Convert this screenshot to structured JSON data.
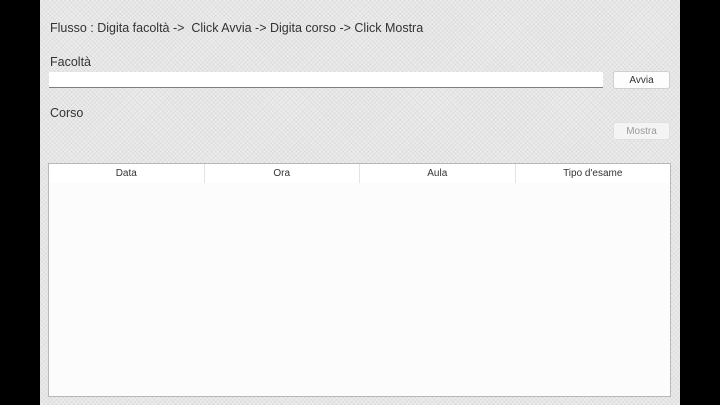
{
  "flow": {
    "text": "Flusso : Digita facoltà ->  Click Avvia -> Digita corso -> Click Mostra"
  },
  "facolta": {
    "label": "Facoltà",
    "value": "",
    "button_label": "Avvia"
  },
  "corso": {
    "label": "Corso",
    "button_label": "Mostra"
  },
  "table": {
    "columns": [
      "Data",
      "Ora",
      "Aula",
      "Tipo d'esame"
    ],
    "rows": []
  }
}
